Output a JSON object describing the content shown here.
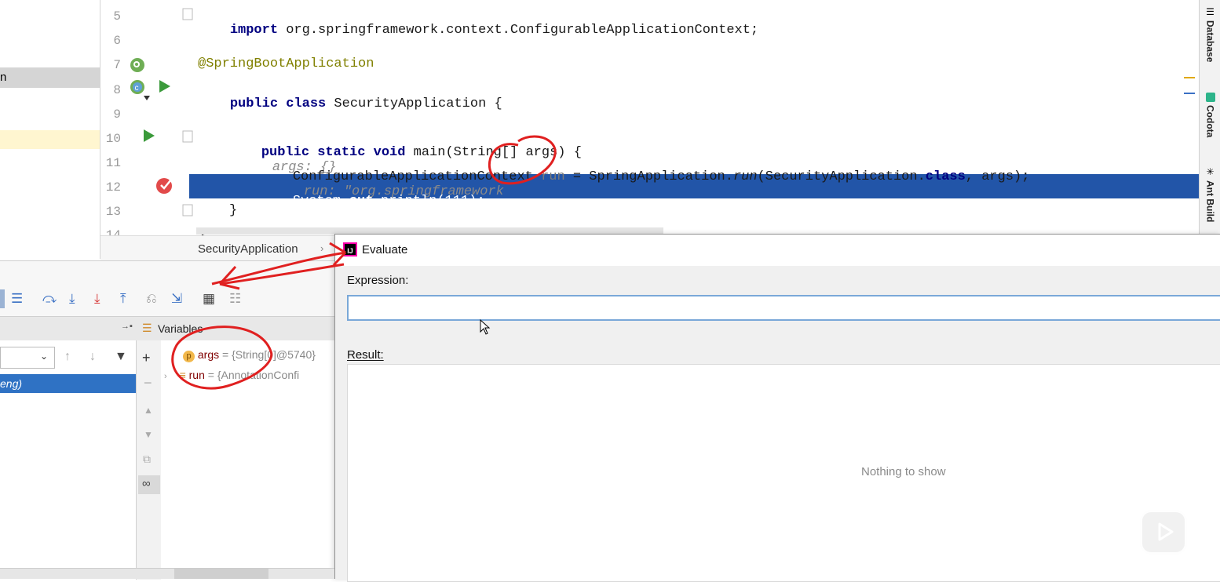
{
  "project_fragment": "n",
  "editor": {
    "lines": [
      {
        "num": "5",
        "text": "import org.springframework.context.ConfigurableApplicationContext;"
      },
      {
        "num": "6",
        "text": ""
      },
      {
        "num": "7",
        "text": "@SpringBootApplication"
      },
      {
        "num": "8",
        "text": "public class SecurityApplication {"
      },
      {
        "num": "9",
        "text": ""
      },
      {
        "num": "10",
        "text": "public static void main(String[] args) {"
      },
      {
        "num": "11",
        "text": "ConfigurableApplicationContext run = SpringApplication.run(SecurityApplication.class, args);"
      },
      {
        "num": "12",
        "text": "System.out.println(111);"
      },
      {
        "num": "13",
        "text": "}"
      },
      {
        "num": "14",
        "text": "}"
      }
    ],
    "hints": {
      "args": "args: {}",
      "run": "run: \"org.springframework"
    },
    "tokens": {
      "import_kw": "import",
      "import_path": " org.springframework.context.ConfigurableApplicationContext;",
      "annotation": "@SpringBootApplication",
      "public_class": "public class",
      "class_name": " SecurityApplication {",
      "main_mods": "public static void",
      "main_sig": " main(String[] args) {",
      "l11_type": "ConfigurableApplicationContext ",
      "l11_var": "run",
      "l11_assign": " = SpringApplication.",
      "l11_call": "run",
      "l11_args1": "(SecurityApplication.",
      "l11_class_kw": "class",
      "l11_args2": ", args);",
      "l12_sys": "System.",
      "l12_out": "out",
      "l12_rest": ".println(111);",
      "close_brace": "}"
    }
  },
  "breadcrumb": {
    "item": "SecurityApplication"
  },
  "tool_tabs": [
    "Database",
    "Codota",
    "Ant Build"
  ],
  "debug": {
    "variables_header": "Variables",
    "frame_selected": "eng)",
    "variables": [
      {
        "badge": "p",
        "name": "args",
        "value": " = {String[0]@5740}"
      },
      {
        "badge": "≡",
        "name": "run",
        "value": " = {AnnotationConfi"
      }
    ]
  },
  "evaluate": {
    "title": "Evaluate",
    "expression_label": "Expression:",
    "expression_value": "",
    "result_label": "Result:",
    "empty_text": "Nothing to show"
  },
  "colors": {
    "current_line": "#2255a8",
    "accent": "#3a70c4",
    "annotation_red": "#e02020"
  }
}
